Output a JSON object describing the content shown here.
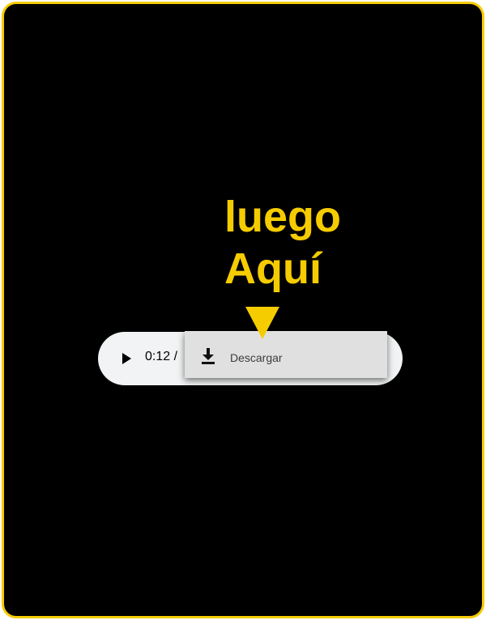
{
  "instruction": {
    "line1": "luego",
    "line2": "Aquí",
    "color": "#f5cc00"
  },
  "audio_player": {
    "play_icon": "play-icon",
    "time_text": "0:12 /"
  },
  "context_menu": {
    "items": [
      {
        "icon": "download-icon",
        "label": "Descargar"
      }
    ]
  }
}
